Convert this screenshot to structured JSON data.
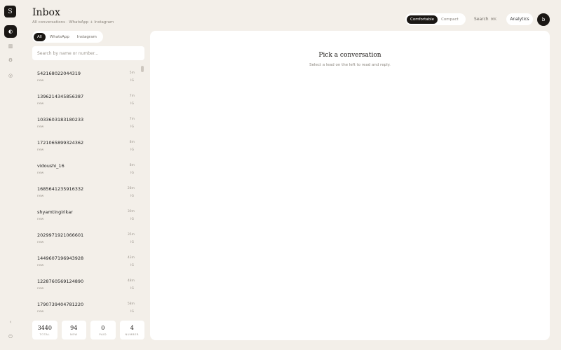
{
  "app": {
    "logo": "S"
  },
  "header": {
    "title": "Inbox",
    "subtitle": "All conversations · WhatsApp + Instagram",
    "density": {
      "options": [
        "Comfortable",
        "Compact"
      ],
      "selected": "Comfortable"
    },
    "search_label": "Search",
    "search_shortcut": "⌘K",
    "analytics_label": "Analytics",
    "avatar_initial": "b"
  },
  "channels": {
    "options": [
      "All",
      "WhatsApp",
      "Instagram"
    ],
    "selected": "All"
  },
  "search": {
    "placeholder": "Search by name or number...",
    "value": ""
  },
  "conversations": [
    {
      "name": "542168022044319",
      "status": "new",
      "time": "5m",
      "source": "IG"
    },
    {
      "name": "1396214345856387",
      "status": "new",
      "time": "7m",
      "source": "IG"
    },
    {
      "name": "1033603183180233",
      "status": "new",
      "time": "7m",
      "source": "IG"
    },
    {
      "name": "1721065899324362",
      "status": "new",
      "time": "8m",
      "source": "IG"
    },
    {
      "name": "vidoushi_16",
      "status": "new",
      "time": "8m",
      "source": "IG"
    },
    {
      "name": "1685641235916332",
      "status": "new",
      "time": "28m",
      "source": "IG"
    },
    {
      "name": "shyamtingirikar",
      "status": "new",
      "time": "30m",
      "source": "IG"
    },
    {
      "name": "2029971921066601",
      "status": "new",
      "time": "35m",
      "source": "IG"
    },
    {
      "name": "1449607196943928",
      "status": "new",
      "time": "43m",
      "source": "IG"
    },
    {
      "name": "1228760569124890",
      "status": "new",
      "time": "48m",
      "source": "IG"
    },
    {
      "name": "1790739404781220",
      "status": "new",
      "time": "58m",
      "source": "IG"
    }
  ],
  "stats": [
    {
      "value": "3440",
      "label": "TOTAL"
    },
    {
      "value": "94",
      "label": "NEW"
    },
    {
      "value": "0",
      "label": "PAID"
    },
    {
      "value": "4",
      "label": "NUMBER"
    }
  ],
  "pane": {
    "empty_title": "Pick a conversation",
    "empty_subtitle": "Select a lead on the left to read and reply."
  }
}
